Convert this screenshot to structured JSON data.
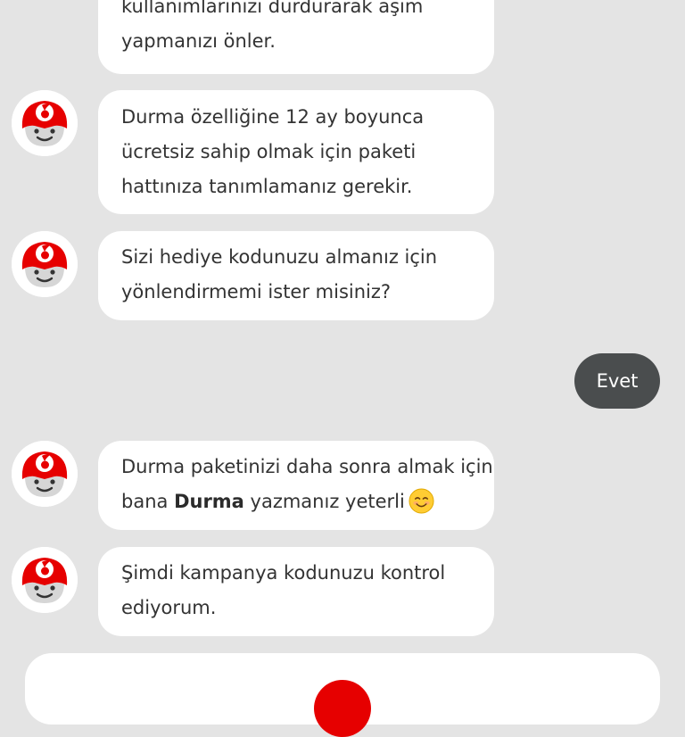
{
  "messages": [
    {
      "from": "bot",
      "lines": [
        "kullanımlarınızı durdurarak aşım",
        "yapmanızı önler."
      ]
    },
    {
      "from": "bot",
      "lines": [
        "Durma özelliğine 12 ay boyunca",
        "ücretsiz sahip olmak için paketi",
        "hattınıza tanımlamanız gerekir."
      ]
    },
    {
      "from": "bot",
      "lines": [
        "Sizi hediye kodunuzu almanız için",
        "yönlendirmemi ister misiniz?"
      ]
    },
    {
      "from": "user",
      "text": "Evet"
    },
    {
      "from": "bot",
      "line1": "Durma paketinizi daha sonra almak için",
      "line2_pre": "bana ",
      "line2_bold": "Durma",
      "line2_post": " yazmanız yeterli",
      "emoji": "smiling-face-emoji"
    },
    {
      "from": "bot",
      "lines": [
        "Şimdi kampanya kodunuzu kontrol",
        "ediyorum."
      ]
    }
  ],
  "icons": {
    "bot_avatar": "tobi-robot-avatar",
    "brand_logo": "vodafone-logo"
  },
  "colors": {
    "background": "#e4e4e4",
    "bot_bubble": "#ffffff",
    "user_bubble": "#4a4d4e",
    "brand_red": "#e60000"
  }
}
